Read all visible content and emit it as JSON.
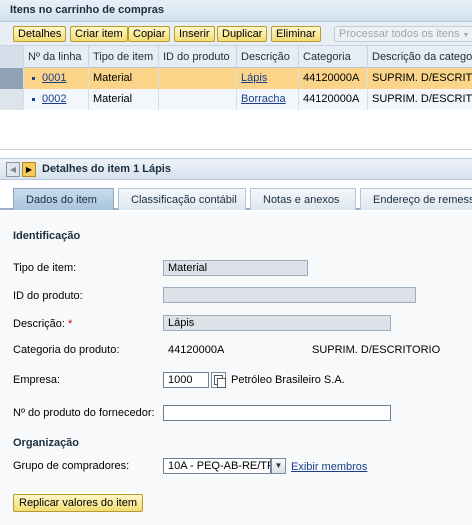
{
  "cart": {
    "title": "Itens no carrinho de compras",
    "toolbar": {
      "details": "Detalhes",
      "create_item": "Criar item",
      "copy": "Copiar",
      "insert": "Inserir",
      "duplicate": "Duplicar",
      "delete": "Eliminar",
      "process_all": "Processar todos os itens"
    },
    "columns": [
      "Nº da linha",
      "Tipo de item",
      "ID do produto",
      "Descrição",
      "Categoria",
      "Descrição da catego"
    ],
    "rows": [
      {
        "line": "0001",
        "type": "Material",
        "product_id": "",
        "description": "Lápis",
        "category": "44120000A",
        "category_desc": "SUPRIM. D/ESCRITOR"
      },
      {
        "line": "0002",
        "type": "Material",
        "product_id": "",
        "description": "Borracha",
        "category": "44120000A",
        "category_desc": "SUPRIM. D/ESCRITOR"
      }
    ]
  },
  "details": {
    "prev_icon": "◀",
    "next_icon": "▶",
    "title": "Detalhes do item 1 Lápis",
    "tabs": [
      "Dados do item",
      "Classificação contábil",
      "Notas e anexos",
      "Endereço de remess"
    ]
  },
  "form": {
    "identification_heading": "Identificação",
    "item_type_label": "Tipo de item:",
    "item_type_value": "Material",
    "product_id_label": "ID do produto:",
    "product_id_value": "",
    "description_label": "Descrição:",
    "required_marker": "*",
    "description_value": "Lápis",
    "product_category_label": "Categoria do produto:",
    "product_category_value": "44120000A",
    "product_category_desc": "SUPRIM. D/ESCRITORIO",
    "company_label": "Empresa:",
    "company_value": "1000",
    "company_name": "Petróleo Brasileiro S.A.",
    "supplier_product_label": "Nº do produto do fornecedor:",
    "supplier_product_value": "",
    "organization_heading": "Organização",
    "buyer_group_label": "Grupo de compradores:",
    "buyer_group_value": "10A - PEQ-AB-RE/TR",
    "show_members_link": "Exibir membros",
    "replicate_button": "Replicar valores do item",
    "dropdown_icon": "▼"
  },
  "colors": {
    "selected_row": "#fbd48a",
    "button_yellow": "#f3dc74",
    "link_blue": "#1a3d8c",
    "active_tab": "#a8c4de"
  }
}
